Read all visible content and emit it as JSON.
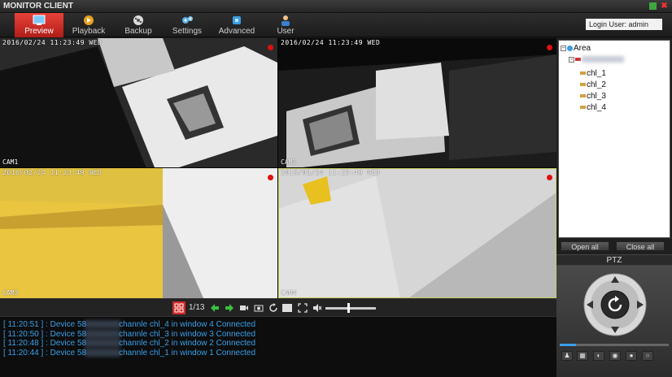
{
  "window": {
    "title": "MONITOR CLIENT"
  },
  "toolbar": {
    "items": [
      {
        "label": "Preview",
        "icon": "preview-icon",
        "active": true
      },
      {
        "label": "Playback",
        "icon": "playback-icon"
      },
      {
        "label": "Backup",
        "icon": "backup-icon"
      },
      {
        "label": "Settings",
        "icon": "settings-icon"
      },
      {
        "label": "Advanced",
        "icon": "advanced-icon"
      },
      {
        "label": "User",
        "icon": "user-icon"
      }
    ],
    "login": "Login User: admin"
  },
  "cameras": [
    {
      "timestamp": "2016/02/24 11:23:49 WED",
      "label": "CAM1"
    },
    {
      "timestamp": "2016/02/24 11:23:49 WED",
      "label": "CAM2"
    },
    {
      "timestamp": "2016/02/24 11:23:49 WED",
      "label": "CAM3"
    },
    {
      "timestamp": "2016/02/24 11:23:49 WED",
      "label": "CAM4"
    }
  ],
  "video_bar": {
    "page": "1/13",
    "volume": 0.45
  },
  "log": [
    {
      "time": "[ 11:20:51 ]",
      "prefix": " : Device 58",
      "suffix": "channle chl_4 in window 4 Connected"
    },
    {
      "time": "[ 11:20:50 ]",
      "prefix": " : Device 58",
      "suffix": "channle chl_3 in window 3 Connected"
    },
    {
      "time": "[ 11:20:48 ]",
      "prefix": " : Device 58",
      "suffix": "channle chl_2 in window 2 Connected"
    },
    {
      "time": "[ 11:20:44 ]",
      "prefix": " : Device 58",
      "suffix": "channle chl_1 in window 1 Connected"
    }
  ],
  "tree": {
    "root": "Area",
    "channels": [
      "chl_1",
      "chl_2",
      "chl_3",
      "chl_4"
    ]
  },
  "buttons": {
    "open_all": "Open all",
    "close_all": "Close all"
  },
  "ptz": {
    "title": "PTZ"
  }
}
